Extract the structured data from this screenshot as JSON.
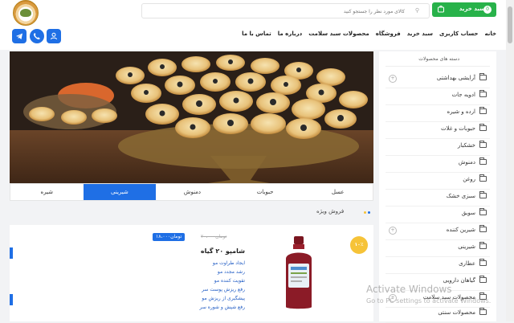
{
  "header": {
    "search_placeholder": "کالای مورد نظر را جستجو کنید",
    "cart_label": "سبد خرید",
    "cart_count": "0",
    "nav": [
      "خانه",
      "حساب کاربری",
      "سبد خرید",
      "فروشگاه",
      "محصولات سبد سلامت",
      "درباره ما",
      "تماس با ما"
    ]
  },
  "sidebar": {
    "title": "دسته های محصولات",
    "items": [
      {
        "label": "آرایشی بهداشتی",
        "expandable": true
      },
      {
        "label": "ادویه جات",
        "expandable": false
      },
      {
        "label": "ارده و شیره",
        "expandable": false
      },
      {
        "label": "حبوبات و غلات",
        "expandable": false
      },
      {
        "label": "خشکبار",
        "expandable": false
      },
      {
        "label": "دمنوش",
        "expandable": false
      },
      {
        "label": "روغن",
        "expandable": false
      },
      {
        "label": "سبزی خشک",
        "expandable": false
      },
      {
        "label": "سویق",
        "expandable": false
      },
      {
        "label": "شیرین کننده",
        "expandable": true
      },
      {
        "label": "شیرینی",
        "expandable": false
      },
      {
        "label": "عطاری",
        "expandable": false
      },
      {
        "label": "گیاهان دارویی",
        "expandable": false
      },
      {
        "label": "محصولات سبد سلامت",
        "expandable": true
      },
      {
        "label": "محصولات سنتی",
        "expandable": false
      }
    ]
  },
  "tabs": {
    "items": [
      "عسل",
      "حبوبات",
      "دمنوش",
      "شیرینی",
      "شیره"
    ],
    "active": "شیرینی"
  },
  "special": {
    "title": "فروش ویژه"
  },
  "product": {
    "discount": "۱۰٪",
    "old_price": "۲۰،۰۰۰تومان",
    "new_price": "۱۸،۰۰۰تومان",
    "title": "شامپو ۲۰ گیاه",
    "features": [
      "ایجاد طراوت مو",
      "رشد مجدد مو",
      "تقویت کننده مو",
      "رفع ریزش پوست سر",
      "پیشگیری از ریزش مو",
      "رفع شپش و شوره سر"
    ]
  },
  "watermark": {
    "line1": "Activate Windows",
    "line2": "Go to PC settings to activate Windows."
  },
  "colors": {
    "accent": "#1f6fe5",
    "cart": "#28b24a"
  }
}
